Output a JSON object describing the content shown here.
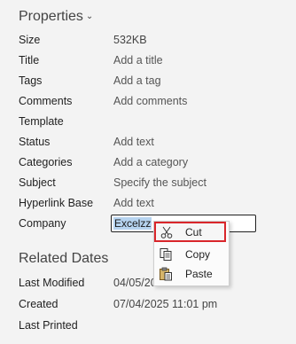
{
  "properties": {
    "title": "Properties",
    "rows": [
      {
        "label": "Size",
        "value": "532KB"
      },
      {
        "label": "Title",
        "value": "Add a title"
      },
      {
        "label": "Tags",
        "value": "Add a tag"
      },
      {
        "label": "Comments",
        "value": "Add comments"
      },
      {
        "label": "Template",
        "value": ""
      },
      {
        "label": "Status",
        "value": "Add text"
      },
      {
        "label": "Categories",
        "value": "Add a category"
      },
      {
        "label": "Subject",
        "value": "Specify the subject"
      },
      {
        "label": "Hyperlink Base",
        "value": "Add text"
      },
      {
        "label": "Company",
        "value": "Excelzz"
      }
    ]
  },
  "context_menu": {
    "items": [
      {
        "label": "Cut",
        "icon": "scissors-icon"
      },
      {
        "label": "Copy",
        "icon": "copy-icon"
      },
      {
        "label": "Paste",
        "icon": "paste-icon"
      }
    ]
  },
  "related_dates": {
    "title": "Related Dates",
    "rows": [
      {
        "label": "Last Modified",
        "value": "04/05/2025 12:13 am"
      },
      {
        "label": "Created",
        "value": "07/04/2025 11:01 pm"
      },
      {
        "label": "Last Printed",
        "value": ""
      }
    ]
  },
  "colors": {
    "highlight": "#d9262b",
    "selection": "#b6d3ef"
  }
}
